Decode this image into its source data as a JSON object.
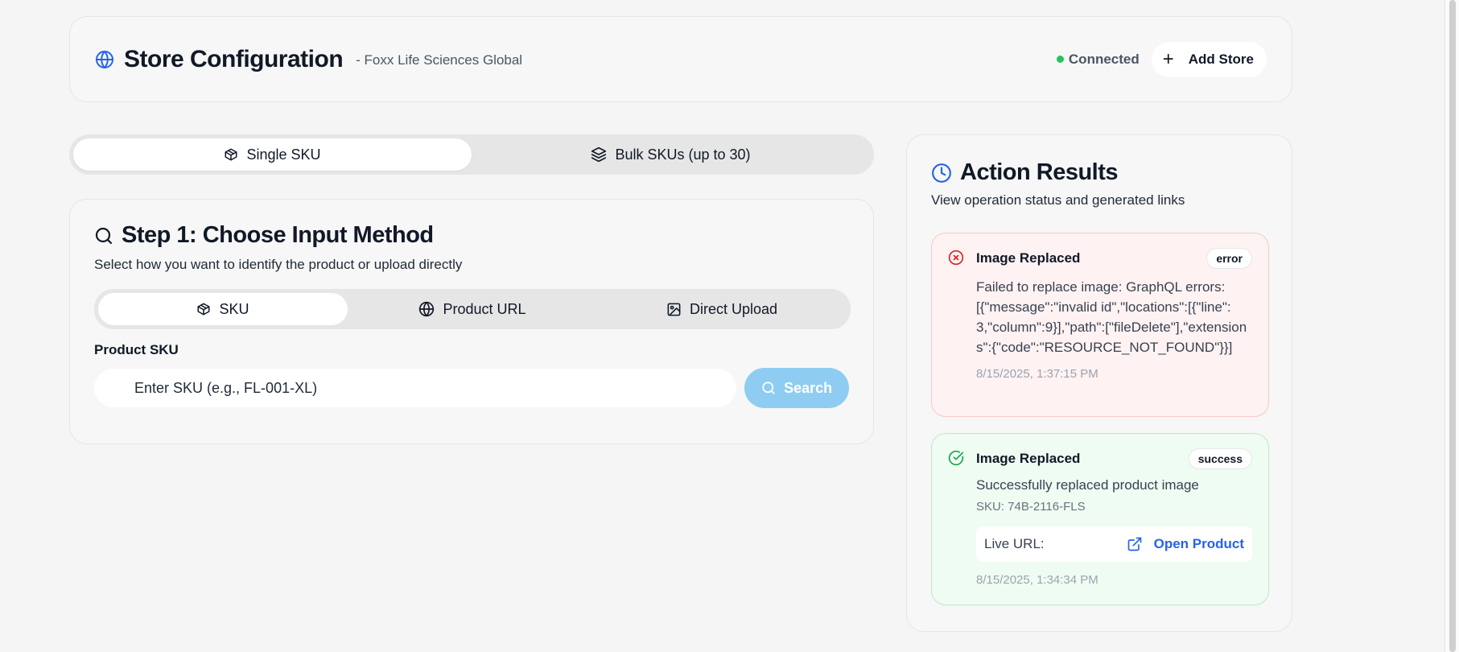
{
  "header": {
    "title": "Store Configuration",
    "subtitle": "- Foxx Life Sciences Global",
    "status": "Connected",
    "add_store": "Add Store"
  },
  "mode_tabs": [
    {
      "label": "Single SKU",
      "icon": "package-icon",
      "active": true
    },
    {
      "label": "Bulk SKUs (up to 30)",
      "icon": "layers-icon",
      "active": false
    }
  ],
  "step": {
    "title": "Step 1: Choose Input Method",
    "description": "Select how you want to identify the product or upload directly",
    "methods": [
      {
        "label": "SKU",
        "icon": "package-icon",
        "active": true
      },
      {
        "label": "Product URL",
        "icon": "globe-icon",
        "active": false
      },
      {
        "label": "Direct Upload",
        "icon": "image-icon",
        "active": false
      }
    ],
    "field_label": "Product SKU",
    "input_placeholder": "Enter SKU (e.g., FL-001-XL)",
    "input_value": "",
    "search_label": "Search"
  },
  "results": {
    "title": "Action Results",
    "description": "View operation status and generated links",
    "items": [
      {
        "name": "Image Replaced",
        "badge": "error",
        "message": "Failed to replace image: GraphQL errors: [{\"message\":\"invalid id\",\"locations\":[{\"line\":3,\"column\":9}],\"path\":[\"fileDelete\"],\"extensions\":{\"code\":\"RESOURCE_NOT_FOUND\"}}]",
        "timestamp": "8/15/2025, 1:37:15 PM"
      },
      {
        "name": "Image Replaced",
        "badge": "success",
        "message": "Successfully replaced product image",
        "sku": "SKU: 74B-2116-FLS",
        "live_label": "Live URL:",
        "link_label": "Open Product",
        "timestamp": "8/15/2025, 1:34:34 PM"
      }
    ]
  },
  "colors": {
    "accent_blue": "#2563eb",
    "status_green": "#22c55e",
    "error_red": "#dc2626",
    "search_button": "#8ecdf1"
  }
}
